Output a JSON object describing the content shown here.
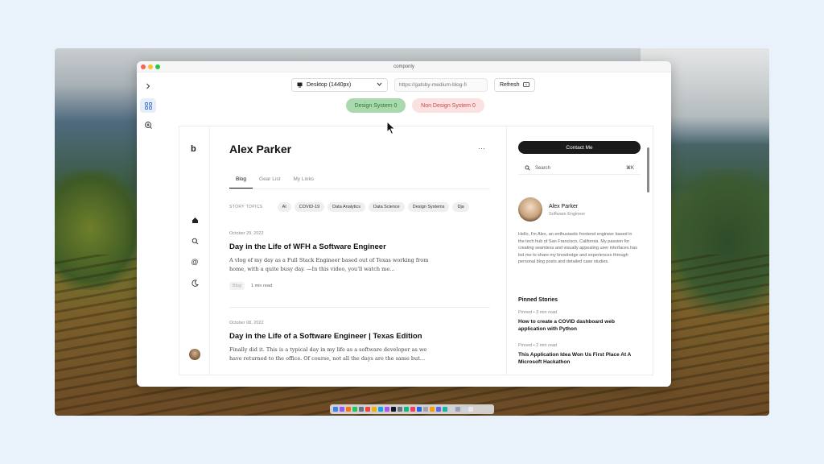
{
  "window": {
    "title": "componly"
  },
  "toolbar": {
    "device_label": "Desktop (1440px)",
    "url_placeholder": "https://gatsby-medium-blog-fi",
    "refresh_label": "Refresh"
  },
  "design_system": {
    "ds_label": "Design System 0",
    "non_ds_label": "Non Design System 0",
    "ds_color": "#a9d9ad",
    "non_ds_color": "#fbe1e1"
  },
  "preview": {
    "logo": "b",
    "name": "Alex Parker",
    "more": "···",
    "tabs": [
      "Blog",
      "Gear List",
      "My Links"
    ],
    "topics_label": "STORY TOPICS",
    "topics": [
      "AI",
      "COVID-19",
      "Data Analytics",
      "Data Science",
      "Design Systems",
      "Dja"
    ],
    "posts": [
      {
        "date": "October 29, 2022",
        "title": "Day in the Life of WFH a Software Engineer",
        "excerpt": "A vlog of my day as a Full Stack Engineer based out of Texas working from home, with a quite busy day. —In this video, you'll watch me…",
        "tag": "Blog",
        "read": "1 min read"
      },
      {
        "date": "October 08, 2022",
        "title": "Day in the Life of a Software Engineer | Texas Edition",
        "excerpt": "Finally did it. This is a typical day in my life as a software developer as we have returned to the office. Of course, not all the days are the same but…"
      }
    ],
    "sidebar": {
      "contact": "Contact Me",
      "search_placeholder": "Search",
      "search_shortcut": "⌘K",
      "profile_name": "Alex Parker",
      "profile_role": "Software Engineer",
      "bio": "Hello, I'm Alex, an enthusiastic frontend engineer based in the tech hub of San Francisco, California. My passion for creating seamless and visually appealing user interfaces has led me to share my knowledge and experiences through personal blog posts and detailed case studies.",
      "pinned_heading": "Pinned Stories",
      "pinned": [
        {
          "meta": "Pinned • 3 min read",
          "title": "How to create a COVID dashboard web application with Python"
        },
        {
          "meta": "Pinned • 2 min read",
          "title": "This Application Idea Won Us First Place At A Microsoft Hackathon"
        }
      ]
    }
  }
}
